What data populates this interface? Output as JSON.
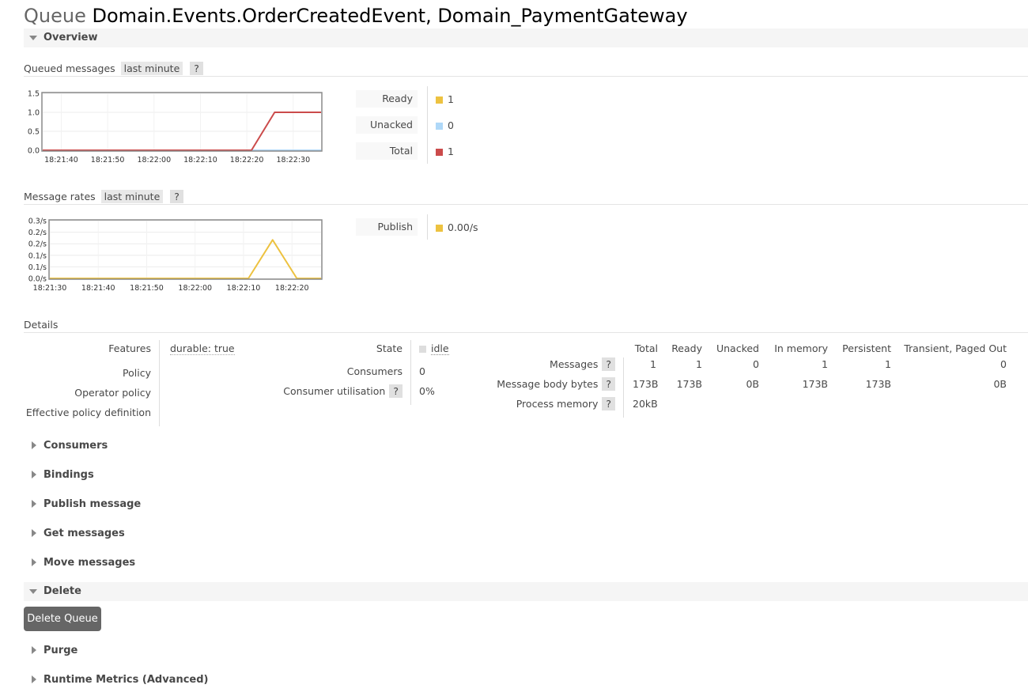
{
  "page": {
    "kind": "Queue",
    "name": "Domain.Events.OrderCreatedEvent, Domain_PaymentGateway"
  },
  "overview": {
    "label": "Overview",
    "queued": {
      "title": "Queued messages",
      "range": "last minute",
      "help": "?",
      "legend": [
        {
          "label": "Ready",
          "value": "1",
          "color": "#edc240"
        },
        {
          "label": "Unacked",
          "value": "0",
          "color": "#afd8f8"
        },
        {
          "label": "Total",
          "value": "1",
          "color": "#cb4b4b"
        }
      ]
    },
    "rates": {
      "title": "Message rates",
      "range": "last minute",
      "help": "?",
      "legend": [
        {
          "label": "Publish",
          "value": "0.00/s",
          "color": "#edc240"
        }
      ]
    }
  },
  "chart_data": [
    {
      "type": "line",
      "title": "Queued messages",
      "ylim": [
        0,
        1.5
      ],
      "y_ticks": [
        "1.5",
        "1.0",
        "0.5",
        "0.0"
      ],
      "x_ticks": [
        "18:21:40",
        "18:21:50",
        "18:22:00",
        "18:22:10",
        "18:22:20",
        "18:22:30"
      ],
      "x": [
        "18:21:36",
        "18:22:01",
        "18:22:21",
        "18:22:26",
        "18:22:36"
      ],
      "series": [
        {
          "name": "Ready",
          "color": "#edc240",
          "values": [
            0,
            0,
            0,
            0,
            0
          ]
        },
        {
          "name": "Unacked",
          "color": "#afd8f8",
          "values": [
            0,
            0,
            0,
            0,
            0
          ]
        },
        {
          "name": "Total",
          "color": "#cb4b4b",
          "values": [
            0,
            0,
            0,
            1,
            1
          ]
        }
      ]
    },
    {
      "type": "line",
      "title": "Message rates",
      "ylim": [
        0,
        0.3
      ],
      "y_ticks": [
        "0.3/s",
        "0.2/s",
        "0.2/s",
        "0.1/s",
        "0.1/s",
        "0.0/s"
      ],
      "x_ticks": [
        "18:21:30",
        "18:21:40",
        "18:21:50",
        "18:22:00",
        "18:22:10",
        "18:22:20"
      ],
      "x": [
        "18:21:30",
        "18:22:11",
        "18:22:16",
        "18:22:21",
        "18:22:26"
      ],
      "series": [
        {
          "name": "Publish",
          "color": "#edc240",
          "values": [
            0,
            0,
            0.2,
            0,
            0
          ]
        }
      ]
    }
  ],
  "details": {
    "title": "Details",
    "features_label": "Features",
    "features_value": "durable: true",
    "policy_label": "Policy",
    "operator_policy_label": "Operator policy",
    "effective_policy_label": "Effective policy definition",
    "state_label": "State",
    "state_value": "idle",
    "consumers_label": "Consumers",
    "consumers_value": "0",
    "utilisation_label": "Consumer utilisation",
    "utilisation_value": "0%",
    "help": "?",
    "table": {
      "headers": [
        "Total",
        "Ready",
        "Unacked",
        "In memory",
        "Persistent",
        "Transient, Paged Out"
      ],
      "rows": [
        {
          "label": "Messages",
          "values": [
            "1",
            "1",
            "0",
            "1",
            "1",
            "0"
          ]
        },
        {
          "label": "Message body bytes",
          "values": [
            "173B",
            "173B",
            "0B",
            "173B",
            "173B",
            "0B"
          ]
        },
        {
          "label": "Process memory",
          "values": [
            "20kB",
            "",
            "",
            "",
            "",
            ""
          ]
        }
      ]
    }
  },
  "sections": {
    "consumers": "Consumers",
    "bindings": "Bindings",
    "publish": "Publish message",
    "get": "Get messages",
    "move": "Move messages",
    "delete": "Delete",
    "delete_button": "Delete Queue",
    "purge": "Purge",
    "runtime": "Runtime Metrics (Advanced)"
  }
}
